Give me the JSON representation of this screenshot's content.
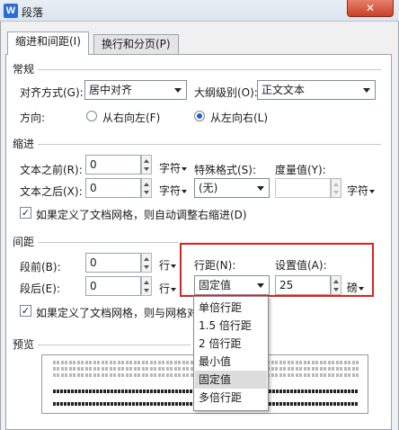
{
  "window": {
    "title": "段落",
    "app_icon": "W",
    "close_glyph": "✕"
  },
  "tabs": [
    {
      "label": "缩进和间距(I)",
      "active": true
    },
    {
      "label": "换行和分页(P)",
      "active": false
    }
  ],
  "general": {
    "section_label": "常规",
    "alignment_label": "对齐方式(G):",
    "alignment_value": "居中对齐",
    "outline_label": "大纲级别(O):",
    "outline_value": "正文文本",
    "direction_label": "方向:",
    "rtl_label": "从右向左(F)",
    "ltr_label": "从左向右(L)",
    "selected_direction": "ltr"
  },
  "indent": {
    "section_label": "缩进",
    "before_label": "文本之前(R):",
    "before_value": "0",
    "before_unit": "字符",
    "after_label": "文本之后(X):",
    "after_value": "0",
    "after_unit": "字符",
    "special_label": "特殊格式(S):",
    "special_value": "(无)",
    "measure_label": "度量值(Y):",
    "measure_unit": "字符",
    "grid_checkbox_label": "如果定义了文档网格，则自动调整右缩进(D)",
    "grid_checked": true
  },
  "spacing": {
    "section_label": "间距",
    "before_label": "段前(B):",
    "before_value": "0",
    "before_unit": "行",
    "after_label": "段后(E):",
    "after_value": "0",
    "after_unit": "行",
    "line_spacing_label": "行距(N):",
    "line_spacing_value": "固定值",
    "set_value_label": "设置值(A):",
    "set_value": "25",
    "set_value_unit": "磅",
    "grid_checkbox_label": "如果定义了文档网格，则与网格对",
    "grid_checked": true
  },
  "preview": {
    "section_label": "预览",
    "sample_prev": "一段落前一段落前一段落前一段落前一段落前一段落前一段落",
    "sample_current": "示例文字示例文字示例文字示例文字示例文字示例文字"
  },
  "line_spacing_dropdown": {
    "options": [
      "单倍行距",
      "1.5 倍行距",
      "2 倍行距",
      "最小值",
      "固定值",
      "多倍行距"
    ],
    "selected_index": 4
  },
  "colors": {
    "highlight_border": "#e0201e",
    "radio_selected": "#2360c4",
    "close_button": "#c8412b"
  }
}
